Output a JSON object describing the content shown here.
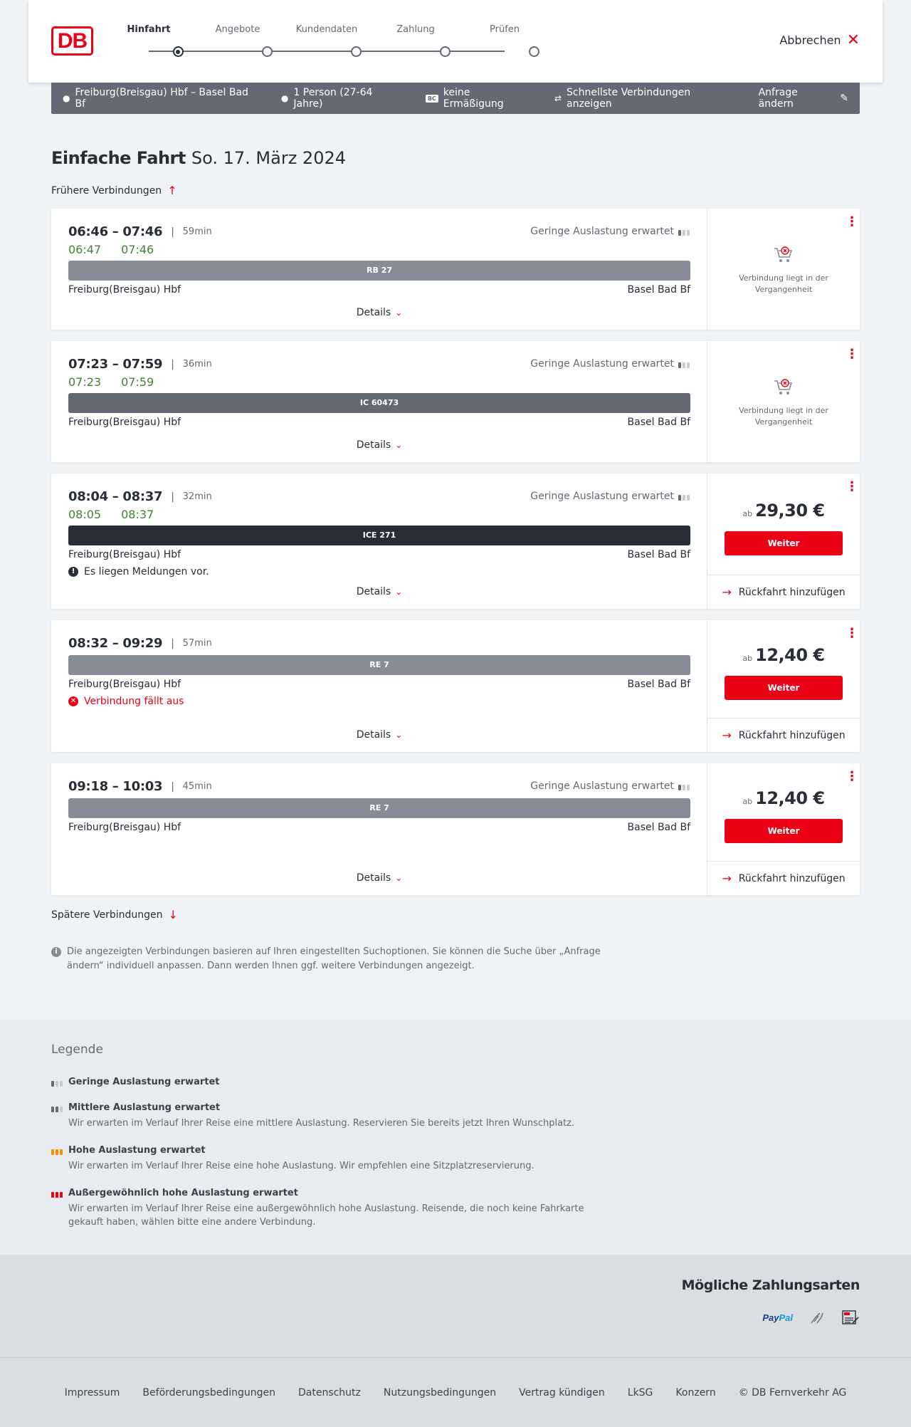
{
  "header": {
    "logo": "DB",
    "steps": [
      "Hinfahrt",
      "Angebote",
      "Kundendaten",
      "Zahlung",
      "Prüfen"
    ],
    "active_step": 0,
    "cancel_label": "Abbrechen"
  },
  "filters": {
    "route": "Freiburg(Breisgau) Hbf – Basel Bad Bf",
    "passengers": "1 Person (27-64 Jahre)",
    "discount_badge": "BC",
    "discount": "keine Ermäßigung",
    "fastest": "Schnellste Verbindungen anzeigen",
    "edit_label": "Anfrage ändern"
  },
  "page": {
    "title": "Einfache Fahrt",
    "date": "So. 17. März 2024",
    "earlier": "Frühere Verbindungen",
    "later": "Spätere Verbindungen",
    "note": "Die angezeigten Verbindungen basieren auf Ihren eingestellten Suchoptionen. Sie können die Suche über „Anfrage ändern“ individuell anpassen. Dann werden Ihnen ggf. weitere Verbindungen angezeigt."
  },
  "connections": [
    {
      "times": "06:46 – 07:46",
      "duration": "59min",
      "rt_dep": "06:47",
      "rt_arr": "07:46",
      "load": "Geringe Auslastung erwartet",
      "train": "RB 27",
      "train_color": "#878c96",
      "from": "Freiburg(Breisgau) Hbf",
      "to": "Basel Bad Bf",
      "details": "Details",
      "past_text": "Verbindung liegt in der Vergangenheit"
    },
    {
      "times": "07:23 – 07:59",
      "duration": "36min",
      "rt_dep": "07:23",
      "rt_arr": "07:59",
      "load": "Geringe Auslastung erwartet",
      "train": "IC 60473",
      "train_color": "#646973",
      "from": "Freiburg(Breisgau) Hbf",
      "to": "Basel Bad Bf",
      "details": "Details",
      "past_text": "Verbindung liegt in der Vergangenheit"
    },
    {
      "times": "08:04 – 08:37",
      "duration": "32min",
      "rt_dep": "08:05",
      "rt_arr": "08:37",
      "load": "Geringe Auslastung erwartet",
      "train": "ICE 271",
      "train_color": "#282d37",
      "from": "Freiburg(Breisgau) Hbf",
      "to": "Basel Bad Bf",
      "message": "Es liegen Meldungen vor.",
      "details": "Details",
      "price_prefix": "ab",
      "price": "29,30 €",
      "button": "Weiter",
      "return": "Rückfahrt hinzufügen"
    },
    {
      "times": "08:32 – 09:29",
      "duration": "57min",
      "train": "RE 7",
      "train_color": "#878c96",
      "from": "Freiburg(Breisgau) Hbf",
      "to": "Basel Bad Bf",
      "message": "Verbindung fällt aus",
      "details": "Details",
      "price_prefix": "ab",
      "price": "12,40 €",
      "button": "Weiter",
      "return": "Rückfahrt hinzufügen"
    },
    {
      "times": "09:18 – 10:03",
      "duration": "45min",
      "load": "Geringe Auslastung erwartet",
      "train": "RE 7",
      "train_color": "#878c96",
      "from": "Freiburg(Breisgau) Hbf",
      "to": "Basel Bad Bf",
      "details": "Details",
      "price_prefix": "ab",
      "price": "12,40 €",
      "button": "Weiter",
      "return": "Rückfahrt hinzufügen"
    }
  ],
  "legend": {
    "title": "Legende",
    "items": [
      {
        "title": "Geringe Auslastung erwartet",
        "desc": "",
        "color": "#646973",
        "level": 1
      },
      {
        "title": "Mittlere Auslastung erwartet",
        "desc": "Wir erwarten im Verlauf Ihrer Reise eine mittlere Auslastung. Reservieren Sie bereits jetzt Ihren Wunschplatz.",
        "color": "#646973",
        "level": 2
      },
      {
        "title": "Hohe Auslastung erwartet",
        "desc": "Wir erwarten im Verlauf Ihrer Reise eine hohe Auslastung. Wir empfehlen eine Sitzplatzreservierung.",
        "color": "#f39200",
        "level": 3
      },
      {
        "title": "Außergewöhnlich hohe Auslastung erwartet",
        "desc": "Wir erwarten im Verlauf Ihrer Reise eine außergewöhnlich hohe Auslastung. Reisende, die noch keine Fahrkarte gekauft haben, wählen bitte eine andere Verbindung.",
        "color": "#ec0016",
        "level": 4
      }
    ]
  },
  "payment": {
    "title": "Mögliche Zahlungsarten",
    "paypal_a": "Pay",
    "paypal_b": "Pal"
  },
  "footer": [
    "Impressum",
    "Beförderungsbedingungen",
    "Datenschutz",
    "Nutzungsbedingungen",
    "Vertrag kündigen",
    "LkSG",
    "Konzern",
    "© DB Fernverkehr AG"
  ],
  "colors": {
    "brand": "#ec0016",
    "realtime": "#408335"
  }
}
